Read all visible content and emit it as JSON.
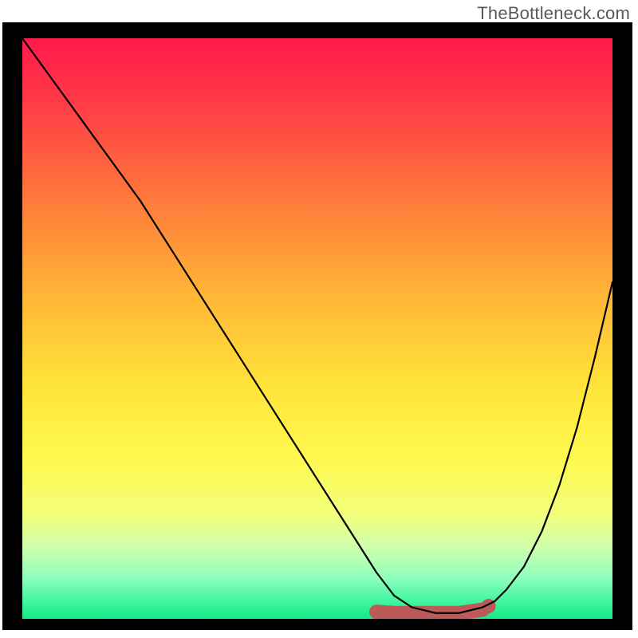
{
  "watermark": {
    "text": "TheBottleneck.com"
  },
  "chart_data": {
    "type": "line",
    "title": "",
    "xlabel": "",
    "ylabel": "",
    "xlim": [
      0,
      100
    ],
    "ylim": [
      0,
      100
    ],
    "grid": false,
    "legend": null,
    "series": [
      {
        "name": "curve",
        "color": "#000000",
        "x": [
          0,
          5,
          10,
          15,
          20,
          25,
          30,
          35,
          40,
          45,
          50,
          55,
          60,
          63,
          66,
          70,
          74,
          78,
          80,
          82,
          85,
          88,
          91,
          94,
          97,
          100
        ],
        "y": [
          100,
          93,
          86,
          79,
          72,
          64,
          56,
          48,
          40,
          32,
          24,
          16,
          8,
          4,
          2,
          1,
          1,
          2,
          3,
          5,
          9,
          15,
          23,
          33,
          45,
          58
        ]
      }
    ],
    "annotations": {
      "valley_highlight": {
        "color": "#bc5a5a",
        "x": [
          60,
          63,
          66,
          70,
          74,
          78
        ],
        "y": [
          1.2,
          1.0,
          1.0,
          1.0,
          1.0,
          1.6
        ]
      },
      "valley_end_dot": {
        "x": 79,
        "y": 2.2,
        "color": "#bc5a5a"
      }
    },
    "background_gradient": {
      "stops": [
        {
          "offset": 0.0,
          "color": "#ff1a4b"
        },
        {
          "offset": 0.1,
          "color": "#ff3747"
        },
        {
          "offset": 0.28,
          "color": "#ff7a3a"
        },
        {
          "offset": 0.45,
          "color": "#ffb836"
        },
        {
          "offset": 0.6,
          "color": "#ffe43a"
        },
        {
          "offset": 0.72,
          "color": "#fff84e"
        },
        {
          "offset": 0.82,
          "color": "#f2ff7a"
        },
        {
          "offset": 0.88,
          "color": "#ccffb0"
        },
        {
          "offset": 0.93,
          "color": "#8dffbd"
        },
        {
          "offset": 0.97,
          "color": "#40f5a0"
        },
        {
          "offset": 1.0,
          "color": "#19e887"
        }
      ]
    }
  }
}
